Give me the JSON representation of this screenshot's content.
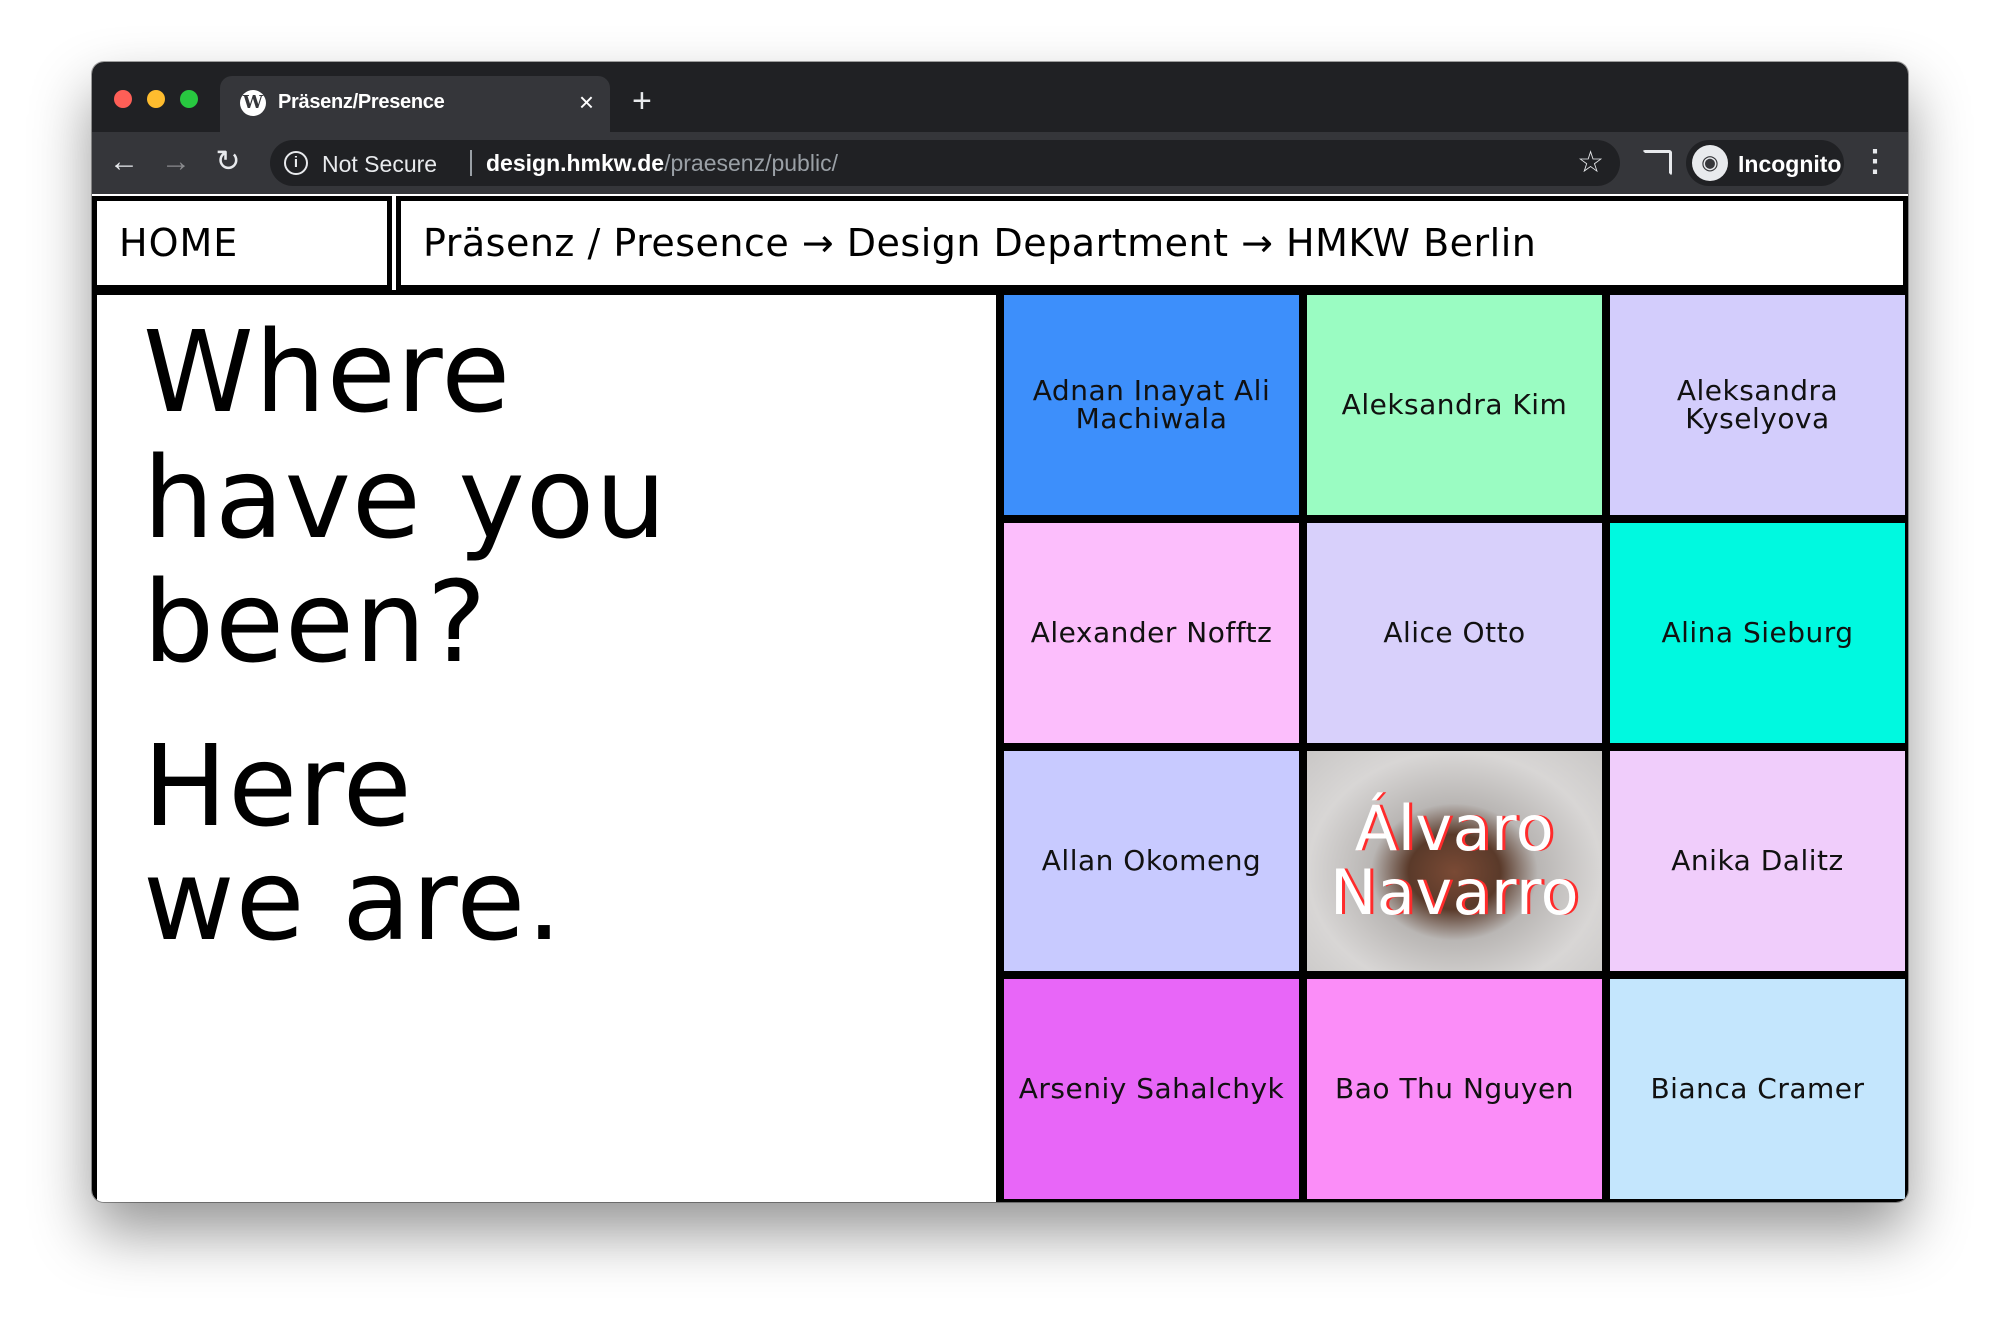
{
  "browser": {
    "tab_title": "Präsenz/Presence",
    "tab_favicon": "W",
    "tab_close": "×",
    "new_tab": "+",
    "nav": {
      "back": "←",
      "forward": "→",
      "reload": "↻"
    },
    "security_label": "Not Secure",
    "url_host": "design.hmkw.de",
    "url_path": "/praesenz/public/",
    "star": "☆",
    "profile_label": "Incognito",
    "menu": "⋮"
  },
  "header": {
    "home": "HOME",
    "breadcrumb": "Präsenz / Presence → Design Department → HMKW Berlin"
  },
  "hero": {
    "line1": "Where",
    "line2": "have you",
    "line3": "been?",
    "line4": "Here",
    "line5": "we are."
  },
  "people": [
    {
      "name": "Adnan Inayat Ali Machiwala",
      "color": "#3d8ffb"
    },
    {
      "name": "Aleksandra Kim",
      "color": "#9afcc2"
    },
    {
      "name": "Aleksandra Kyselyova",
      "color": "#d3cdfc"
    },
    {
      "name": "Alexander Nofftz",
      "color": "#fcbefc"
    },
    {
      "name": "Alice Otto",
      "color": "#d8d0fb"
    },
    {
      "name": "Alina Sieburg",
      "color": "#00f9e0"
    },
    {
      "name": "Allan Okomeng",
      "color": "#c8caff"
    },
    {
      "name": "Álvaro Navarro",
      "color": "#c8c6c5"
    },
    {
      "name": "Anika Dalitz",
      "color": "#f0cdfb"
    },
    {
      "name": "Arseniy Sahalchyk",
      "color": "#e866f8"
    },
    {
      "name": "Bao Thu Nguyen",
      "color": "#fb8df8"
    },
    {
      "name": "Bianca Cramer",
      "color": "#c4e6fd"
    }
  ]
}
